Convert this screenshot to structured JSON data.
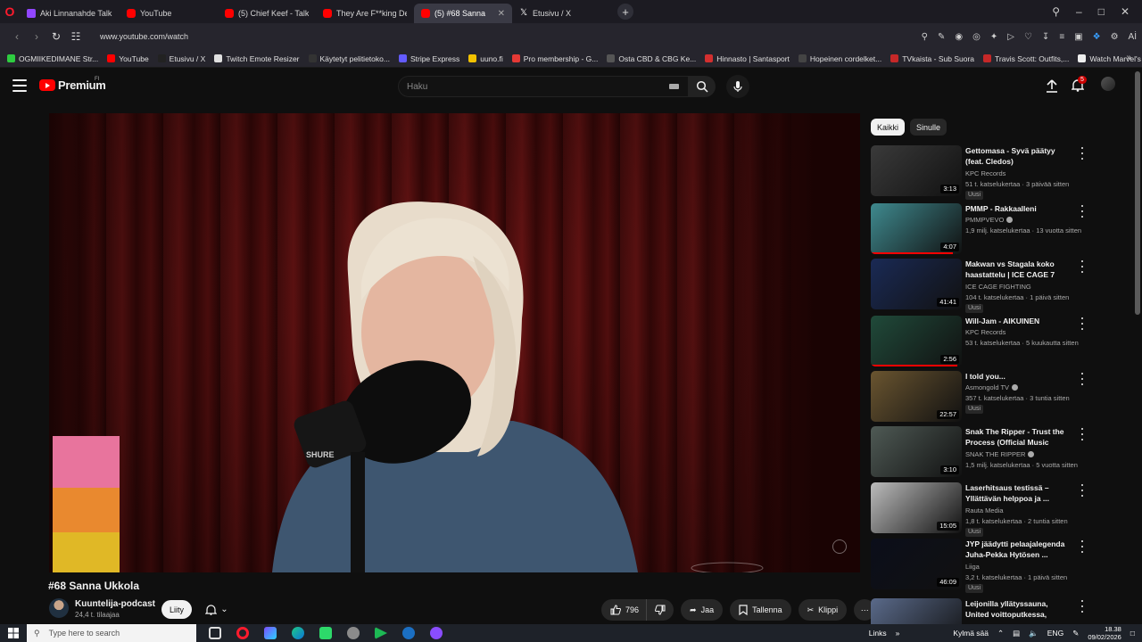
{
  "browser": {
    "tabs": [
      {
        "label": "Aki Linnanahde Talk Show",
        "icon": "twitch",
        "active": false
      },
      {
        "label": "YouTube",
        "icon": "yt",
        "active": false
      },
      {
        "label": "(5) Chief Keef - Talking Id...",
        "icon": "yt",
        "active": false
      },
      {
        "label": "They Are F**king Desperat...",
        "icon": "yt",
        "active": false
      },
      {
        "label": "(5) #68 Sanna Ukkola",
        "icon": "yt",
        "active": true
      },
      {
        "label": "Etusivu / X",
        "icon": "x",
        "active": false
      }
    ],
    "url": "www.youtube.com/watch",
    "bookmarks": [
      {
        "label": "OGMIIKEDIMANE Str...",
        "color": "#2ecc40"
      },
      {
        "label": "YouTube",
        "color": "#ff0000"
      },
      {
        "label": "Etusivu / X",
        "color": "#222222"
      },
      {
        "label": "Twitch Emote Resizer",
        "color": "#e0e0e0"
      },
      {
        "label": "Käytetyt pelitietoko...",
        "color": "#333333"
      },
      {
        "label": "Stripe Express",
        "color": "#635bff"
      },
      {
        "label": "uuno.fi",
        "color": "#f2c200"
      },
      {
        "label": "Pro membership - G...",
        "color": "#e53935"
      },
      {
        "label": "Osta CBD & CBG Ke...",
        "color": "#555555"
      },
      {
        "label": "Hinnasto | Santasport",
        "color": "#d32f2f"
      },
      {
        "label": "Hopeinen cordelket...",
        "color": "#444444"
      },
      {
        "label": "TVkaista - Sub Suora",
        "color": "#c62828"
      },
      {
        "label": "Travis Scott: Outfits,...",
        "color": "#c62828"
      },
      {
        "label": "Watch Marvel's Luk...",
        "color": "#eeeeee"
      }
    ]
  },
  "youtube": {
    "brand": "Premium",
    "country": "FI",
    "search_placeholder": "Haku",
    "notifications": "5",
    "video": {
      "title": "#68 Sanna Ukkola",
      "channel": "Kuuntelija-podcast",
      "subscribers": "24,4 t. tilaajaa",
      "join_label": "Liity",
      "likes": "796",
      "share_label": "Jaa",
      "save_label": "Tallenna",
      "clip_label": "Klippi"
    },
    "chips": [
      "Kaikki",
      "Sinulle"
    ],
    "recommendations": [
      {
        "title": "Gettomasa - Syvä päätyy (feat. Cledos)",
        "channel": "KPC Records",
        "verified": false,
        "meta": "51 t. katselukertaa · 3 päivää sitten",
        "badge": "Uusi",
        "duration": "3:13",
        "thumb": "#3a3a3a",
        "progress": 0
      },
      {
        "title": "PMMP - Rakkaalleni",
        "channel": "PMMPVEVO",
        "verified": true,
        "meta": "1,9 milj. katselukertaa · 13 vuotta sitten",
        "badge": "",
        "duration": "4:07",
        "thumb": "#3f8a8f",
        "progress": 0.9
      },
      {
        "title": "Makwan vs Stagala koko haastattelu | ICE CAGE 7",
        "channel": "ICE CAGE FIGHTING",
        "verified": false,
        "meta": "104 t. katselukertaa · 1 päivä sitten",
        "badge": "Uusi",
        "duration": "41:41",
        "thumb": "#1a2a55",
        "progress": 0
      },
      {
        "title": "Will-Jam - AIKUINEN",
        "channel": "KPC Records",
        "verified": false,
        "meta": "53 t. katselukertaa · 5 kuukautta sitten",
        "badge": "",
        "duration": "2:56",
        "thumb": "#204a3a",
        "progress": 0.95
      },
      {
        "title": "I told you...",
        "channel": "Asmongold TV",
        "verified": true,
        "meta": "357 t. katselukertaa · 3 tuntia sitten",
        "badge": "Uusi",
        "duration": "22:57",
        "thumb": "#6a5530",
        "progress": 0
      },
      {
        "title": "Snak The Ripper - Trust the Process (Official Music Video)",
        "channel": "SNAK THE RIPPER",
        "verified": true,
        "meta": "1,5 milj. katselukertaa · 5 vuotta sitten",
        "badge": "",
        "duration": "3:10",
        "thumb": "#4f5a55",
        "progress": 0
      },
      {
        "title": "Laserhitsaus testissä – Yllättävän helppoa ja ...",
        "channel": "Rauta Media",
        "verified": false,
        "meta": "1,8 t. katselukertaa · 2 tuntia sitten",
        "badge": "Uusi",
        "duration": "15:05",
        "thumb": "#bcbcbc",
        "progress": 0
      },
      {
        "title": "JYP jäädytti pelaajalegenda Juha-Pekka Hytösen ...",
        "channel": "Liiga",
        "verified": false,
        "meta": "3,2 t. katselukertaa · 1 päivä sitten",
        "badge": "Uusi",
        "duration": "46:09",
        "thumb": "#0b0e1a",
        "progress": 0
      },
      {
        "title": "Leijonilla yllätyssauna, United voittoputkessa, Vieraana Lass...",
        "channel": "",
        "verified": false,
        "meta": "",
        "badge": "",
        "duration": "",
        "thumb": "#5a6a8a",
        "progress": 0
      }
    ]
  },
  "taskbar": {
    "search_placeholder": "Type here to search",
    "links_label": "Links",
    "weather": "Kylmä sää",
    "lang": "ENG",
    "time": "18.38",
    "date": "09/02/2026"
  }
}
